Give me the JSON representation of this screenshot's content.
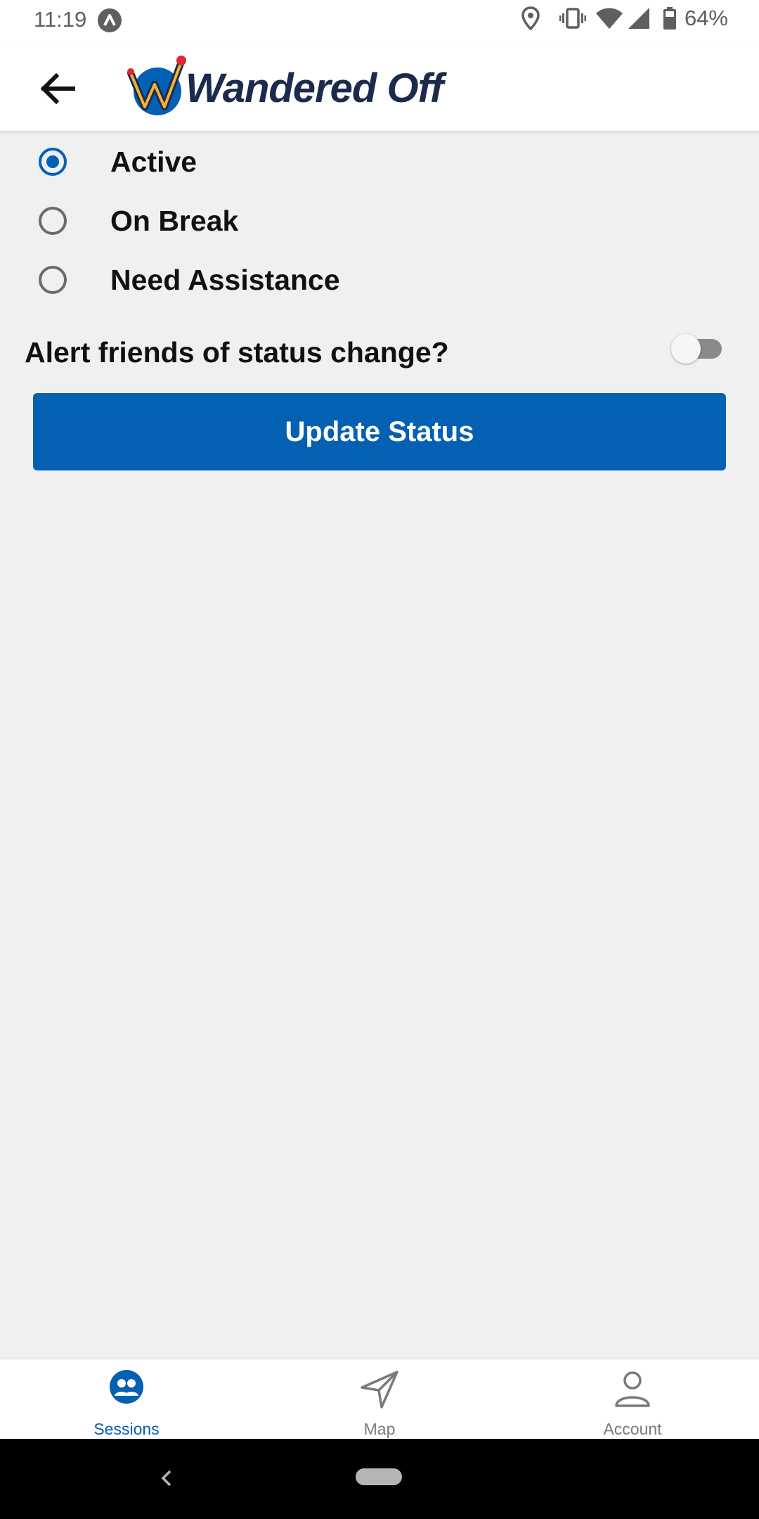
{
  "status_bar": {
    "time": "11:19",
    "battery_percent": "64%",
    "icons": [
      "app-notification-icon",
      "location-icon",
      "vibrate-icon",
      "wifi-icon",
      "signal-icon",
      "battery-icon"
    ]
  },
  "app_bar": {
    "back_icon": "arrow-back-icon",
    "logo_text": "Wandered Off"
  },
  "status_options": [
    {
      "label": "Active",
      "checked": true
    },
    {
      "label": "On Break",
      "checked": false
    },
    {
      "label": "Need Assistance",
      "checked": false
    }
  ],
  "alert_friends": {
    "label": "Alert friends of status change?",
    "enabled": false
  },
  "update_button": {
    "label": "Update Status"
  },
  "tabs": [
    {
      "label": "Sessions",
      "icon": "people-icon",
      "active": true
    },
    {
      "label": "Map",
      "icon": "navigation-arrow-icon",
      "active": false
    },
    {
      "label": "Account",
      "icon": "person-icon",
      "active": false
    }
  ],
  "colors": {
    "accent": "#0460b3",
    "background": "#f0f0f0",
    "inactive": "#7a7a7a"
  }
}
